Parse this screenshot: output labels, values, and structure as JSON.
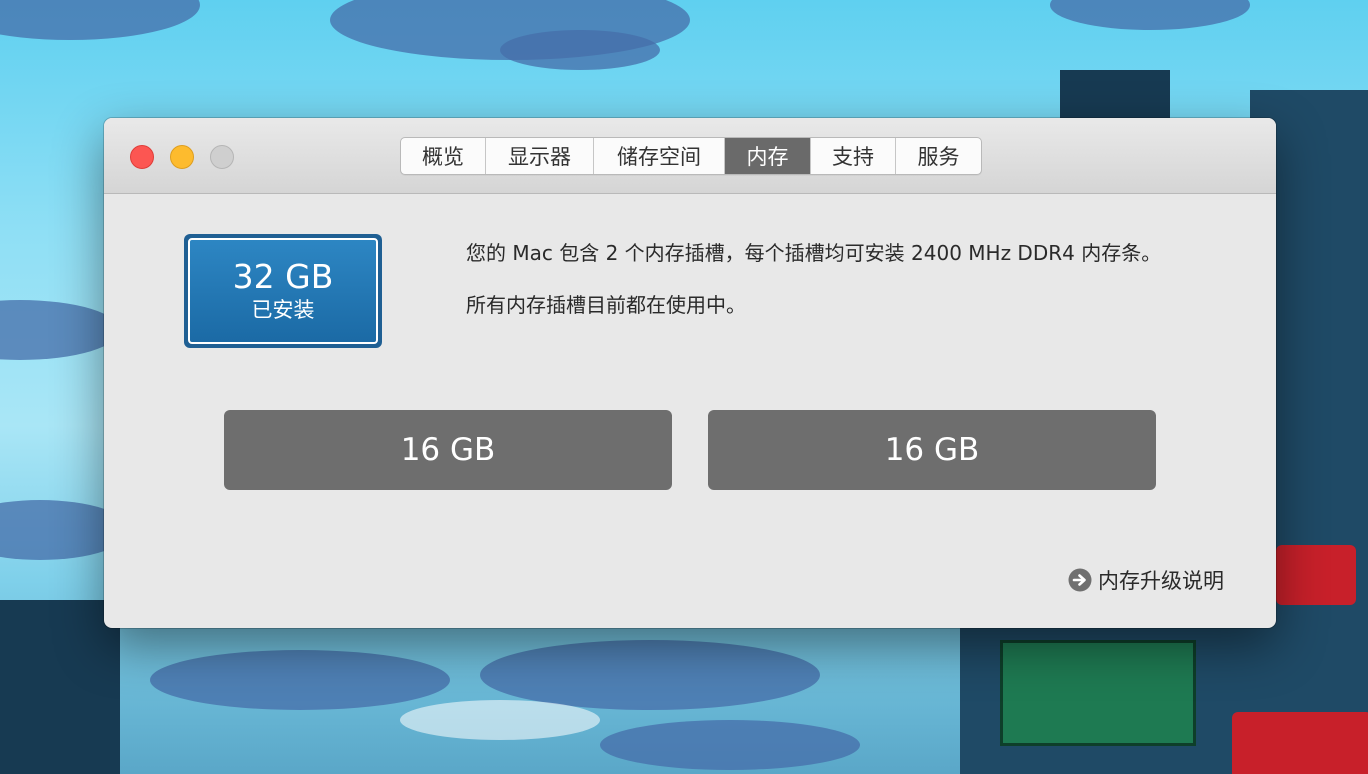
{
  "tabs": [
    {
      "label": "概览",
      "active": false
    },
    {
      "label": "显示器",
      "active": false
    },
    {
      "label": "储存空间",
      "active": false
    },
    {
      "label": "内存",
      "active": true
    },
    {
      "label": "支持",
      "active": false
    },
    {
      "label": "服务",
      "active": false
    }
  ],
  "memory": {
    "installed_size": "32 GB",
    "installed_label": "已安装",
    "info_line1": "您的 Mac 包含 2 个内存插槽，每个插槽均可安装 2400 MHz DDR4 内存条。",
    "info_line2": "所有内存插槽目前都在使用中。",
    "slots": [
      {
        "size": "16 GB"
      },
      {
        "size": "16 GB"
      }
    ],
    "upgrade_link": "内存升级说明"
  },
  "colors": {
    "installed_badge": "#1f6fae",
    "slot_fill": "#6e6e6e",
    "active_tab": "#6a6a6a",
    "close": "#fc5652",
    "minimize": "#fdbb2e",
    "zoom_disabled": "#cfcfcf"
  },
  "icons": {
    "upgrade_link_icon": "arrow-right-circle-icon"
  }
}
